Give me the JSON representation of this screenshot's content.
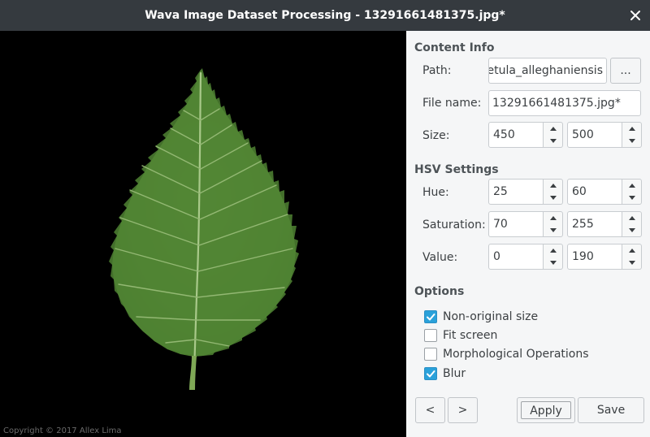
{
  "window": {
    "title": "Wava Image Dataset Processing - 13291661481375.jpg*"
  },
  "image_pane": {
    "copyright": "Copyright © 2017 Allex Lima"
  },
  "content_info": {
    "title": "Content Info",
    "path_label": "Path:",
    "path_value": "/betula_alleghaniensis",
    "browse_label": "...",
    "filename_label": "File name:",
    "filename_value": "13291661481375.jpg*",
    "size_label": "Size:",
    "size_width": "450",
    "size_height": "500"
  },
  "hsv_settings": {
    "title": "HSV Settings",
    "hue_label": "Hue:",
    "hue_min": "25",
    "hue_max": "60",
    "saturation_label": "Saturation:",
    "saturation_min": "70",
    "saturation_max": "255",
    "value_label": "Value:",
    "value_min": "0",
    "value_max": "190"
  },
  "options": {
    "title": "Options",
    "items": [
      {
        "label": "Non-original size",
        "checked": true
      },
      {
        "label": "Fit screen",
        "checked": false
      },
      {
        "label": "Morphological Operations",
        "checked": false
      },
      {
        "label": "Blur",
        "checked": true
      }
    ]
  },
  "footer": {
    "prev_label": "<",
    "next_label": ">",
    "apply_label": "Apply",
    "save_label": "Save"
  },
  "colors": {
    "titlebar": "#353a3f",
    "accent_check": "#2aa1da",
    "panel_bg": "#f5f6f7",
    "leaf": "#5a8f3a"
  }
}
